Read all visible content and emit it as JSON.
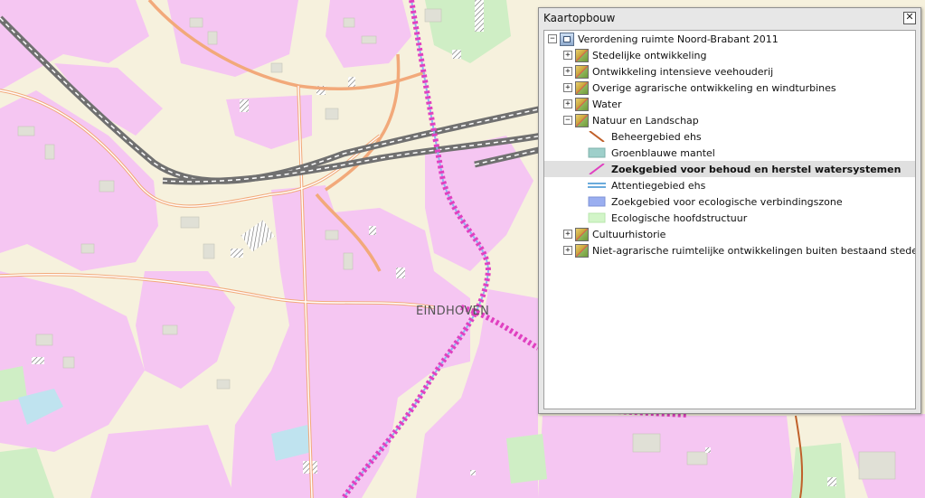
{
  "map": {
    "city_label": "EINDHOVEN",
    "colors": {
      "background": "#f6f1dd",
      "urban_pink": "#f5c6f2",
      "green": "#cfeec5",
      "water": "#bfe3ef",
      "railway": "#707070",
      "road": "#f2a97a"
    }
  },
  "panel": {
    "title": "Kaartopbouw",
    "close_label": "✕",
    "tree": {
      "root": {
        "label": "Verordening ruimte Noord-Brabant 2011",
        "expander": "−"
      },
      "groups": [
        {
          "label": "Stedelijke ontwikkeling",
          "expander": "+"
        },
        {
          "label": "Ontwikkeling intensieve veehouderij",
          "expander": "+"
        },
        {
          "label": "Overige agrarische ontwikkeling en windturbines",
          "expander": "+"
        },
        {
          "label": "Water",
          "expander": "+"
        },
        {
          "label": "Natuur en Landschap",
          "expander": "−"
        }
      ],
      "legend": [
        {
          "label": "Beheergebied ehs",
          "symbol": "diagonal-line",
          "color": "#c0602a"
        },
        {
          "label": "Groenblauwe mantel",
          "symbol": "fill",
          "color": "#9ecfca"
        },
        {
          "label": "Zoekgebied voor behoud en herstel watersystemen",
          "symbol": "diagonal-line",
          "color": "#e040c0"
        },
        {
          "label": "Attentiegebied ehs",
          "symbol": "double-line",
          "color": "#3a8fd0"
        },
        {
          "label": "Zoekgebied voor ecologische verbindingszone",
          "symbol": "fill",
          "color": "#9aaef0"
        },
        {
          "label": "Ecologische hoofdstructuur",
          "symbol": "fill",
          "color": "#d2f5c8"
        }
      ],
      "more_groups": [
        {
          "label": "Cultuurhistorie",
          "expander": "+"
        },
        {
          "label": "Niet-agrarische ruimtelijke ontwikkelingen buiten bestaand stedelijk gebied",
          "expander": "+"
        }
      ]
    }
  }
}
